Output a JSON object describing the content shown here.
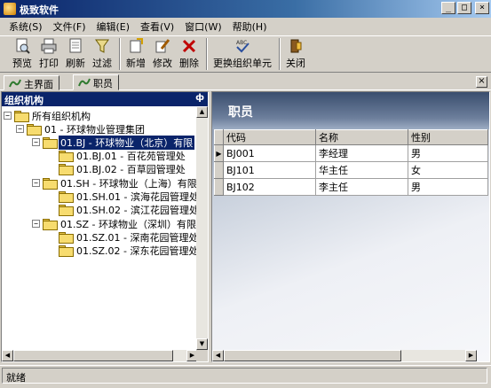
{
  "window": {
    "title": "极致软件",
    "minimize": "_",
    "maximize": "□",
    "close": "×"
  },
  "menu": [
    "系统(S)",
    "文件(F)",
    "编辑(E)",
    "查看(V)",
    "窗口(W)",
    "帮助(H)"
  ],
  "toolbar": [
    {
      "label": "预览",
      "icon": "preview-icon"
    },
    {
      "label": "打印",
      "icon": "print-icon"
    },
    {
      "label": "刷新",
      "icon": "refresh-icon"
    },
    {
      "label": "过滤",
      "icon": "filter-icon"
    },
    {
      "label": "新增",
      "icon": "add-icon"
    },
    {
      "label": "修改",
      "icon": "edit-icon"
    },
    {
      "label": "删除",
      "icon": "delete-icon"
    },
    {
      "label": "更换组织单元",
      "icon": "change-org-icon"
    },
    {
      "label": "关闭",
      "icon": "close-door-icon"
    }
  ],
  "tabs": [
    {
      "label": "主界面"
    },
    {
      "label": "职员"
    }
  ],
  "tab_close": "×",
  "left_panel": {
    "title": "组织机构",
    "pin": "ф",
    "tree": [
      {
        "label": "所有组织机构",
        "level": 0,
        "expander": "−"
      },
      {
        "label": "01 - 环球物业管理集团",
        "level": 1,
        "expander": "−"
      },
      {
        "label": "01.BJ - 环球物业（北京）有限",
        "level": 2,
        "expander": "−",
        "selected": true
      },
      {
        "label": "01.BJ.01 - 百花苑管理处",
        "level": 3
      },
      {
        "label": "01.BJ.02 - 百草园管理处",
        "level": 3
      },
      {
        "label": "01.SH - 环球物业（上海）有限",
        "level": 2,
        "expander": "−"
      },
      {
        "label": "01.SH.01 - 滨海花园管理处",
        "level": 3
      },
      {
        "label": "01.SH.02 - 滨江花园管理处",
        "level": 3
      },
      {
        "label": "01.SZ - 环球物业（深圳）有限",
        "level": 2,
        "expander": "−"
      },
      {
        "label": "01.SZ.01 - 深南花园管理处",
        "level": 3
      },
      {
        "label": "01.SZ.02 - 深东花园管理处",
        "level": 3
      }
    ]
  },
  "main": {
    "banner_title": "职员",
    "columns": [
      "代码",
      "名称",
      "性别"
    ],
    "rows": [
      {
        "code": "BJ001",
        "name": "李经理",
        "gender": "男",
        "current": true
      },
      {
        "code": "BJ101",
        "name": "华主任",
        "gender": "女"
      },
      {
        "code": "BJ102",
        "name": "李主任",
        "gender": "男"
      }
    ],
    "row_marker": "▶"
  },
  "scroll_arrows": {
    "up": "▲",
    "down": "▼",
    "left": "◀",
    "right": "▶"
  },
  "status": {
    "text": "就绪"
  }
}
